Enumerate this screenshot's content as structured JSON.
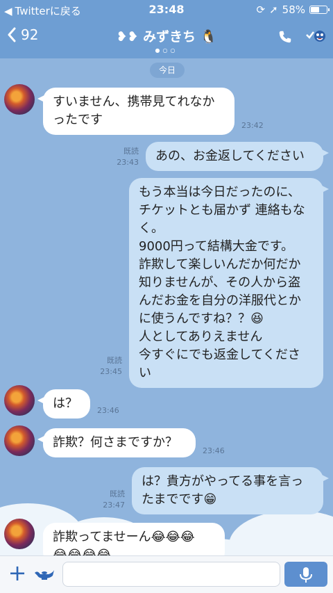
{
  "status_bar": {
    "back_app": "Twitterに戻る",
    "time": "23:48",
    "battery": "58%",
    "battery_level": 0.58
  },
  "header": {
    "unread_count": "92",
    "title": "みずきち"
  },
  "chat": {
    "date_label": "今日",
    "messages": [
      {
        "side": "in",
        "text": "すいません、携帯見てれなか\nったです",
        "time": "23:42"
      },
      {
        "side": "out",
        "text": "あの、お金返してください",
        "read": "既読",
        "time": "23:43"
      },
      {
        "side": "out",
        "text": "もう本当は今日だったのに、\nチケットとも届かず 連絡もな\nく。\n9000円って結構大金です。\n詐欺して楽しいんだか何だか\n知りませんが、その人から盗\nんだお金を自分の洋服代とか\nに使うんですね？？😆\n人としてありえません\n今すぐにでも返金してくださ\nい",
        "read": "既読",
        "time": "23:45"
      },
      {
        "side": "in",
        "text": "は？",
        "time": "23:46"
      },
      {
        "side": "in",
        "text": "詐欺？何さまですか？",
        "time": "23:46"
      },
      {
        "side": "out",
        "text": "は？貴方がやってる事を言っ\nたまでです😁",
        "read": "既読",
        "time": "23:47"
      },
      {
        "side": "in",
        "text": "詐欺ってませーん😂😂😂\n😂😂😂😂",
        "time": ""
      }
    ]
  },
  "input": {
    "placeholder": ""
  },
  "colors": {
    "header": "#6e9ed3",
    "chat_bg": "#8fb4dd",
    "outgoing": "#c9e0f5",
    "incoming": "#ffffff"
  }
}
